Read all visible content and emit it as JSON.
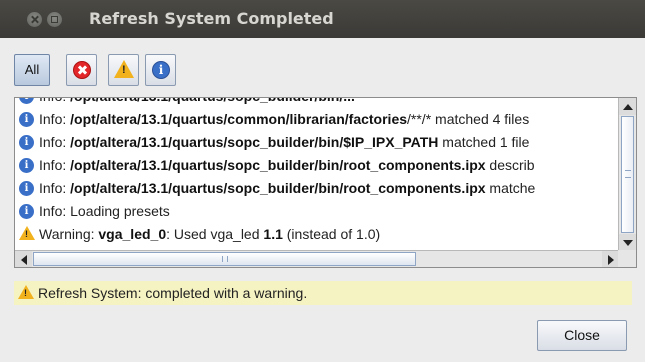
{
  "window": {
    "title": "Refresh System Completed"
  },
  "toolbar": {
    "all_label": "All",
    "info_glyph": "i",
    "warn_glyph": "!"
  },
  "log": {
    "rows": [
      {
        "type": "info",
        "prefix": "Info: ",
        "bold": "/opt/altera/13.1/quartus/common/librarian/factories",
        "rest": "/**/* matched 4 files"
      },
      {
        "type": "info",
        "prefix": "Info: ",
        "bold": "/opt/altera/13.1/quartus/sopc_builder/bin/$IP_IPX_PATH",
        "rest": " matched 1 file"
      },
      {
        "type": "info",
        "prefix": "Info: ",
        "bold": "/opt/altera/13.1/quartus/sopc_builder/bin/root_components.ipx",
        "rest": " describ"
      },
      {
        "type": "info",
        "prefix": "Info: ",
        "bold": "/opt/altera/13.1/quartus/sopc_builder/bin/root_components.ipx",
        "rest": " matche"
      },
      {
        "type": "info",
        "prefix": "Info: ",
        "bold": "",
        "rest": "Loading presets"
      },
      {
        "type": "warning",
        "prefix": "Warning: ",
        "bold": "vga_led_0",
        "rest": ": Used vga_led ",
        "bold2": "1.1",
        "rest2": " (instead of 1.0)"
      }
    ]
  },
  "status": {
    "message": "Refresh System: completed with a warning."
  },
  "footer": {
    "close_label": "Close"
  },
  "colors": {
    "titlebar": "#3b3a36",
    "status_bg": "#f6f3c2",
    "info": "#3a6fc8",
    "warning": "#f1b21d",
    "error": "#e3262a"
  }
}
